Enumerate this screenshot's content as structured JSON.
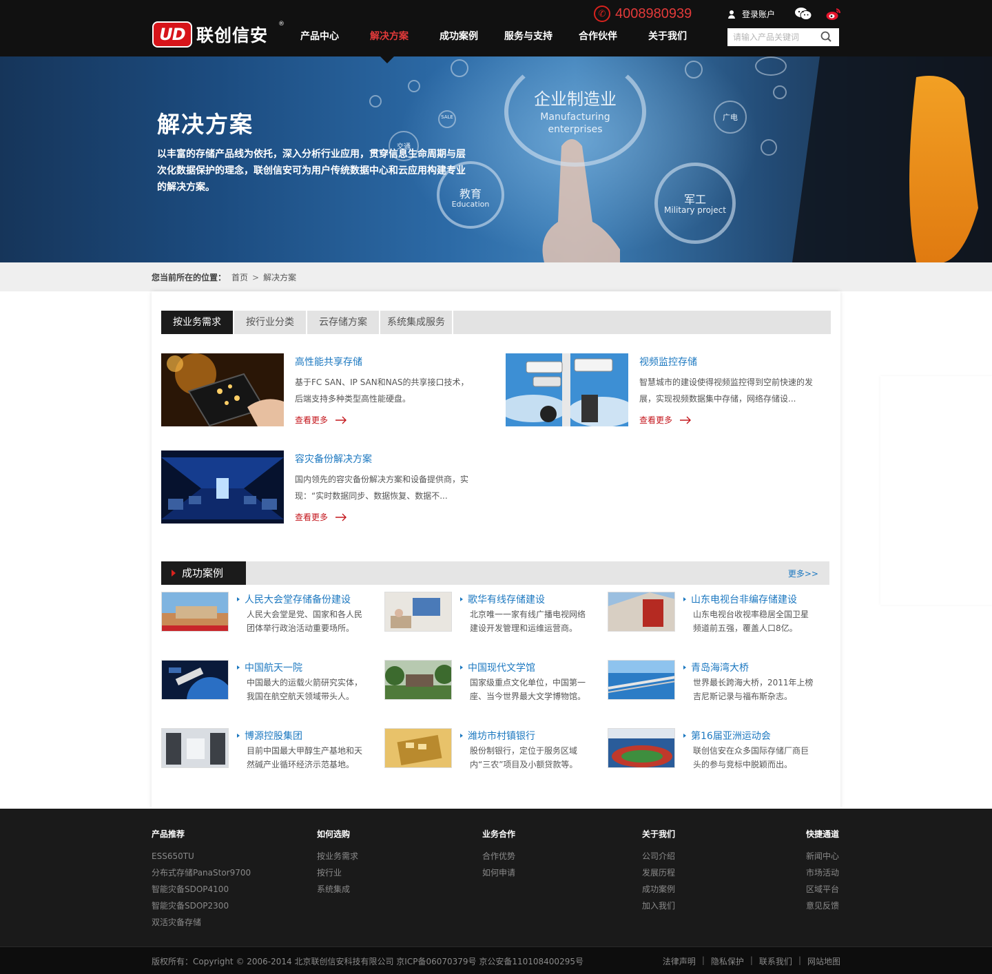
{
  "header": {
    "logo_badge": "UD",
    "logo_text": "联创信安",
    "logo_reg": "®",
    "phone": "4008980939",
    "login_label": "登录账户",
    "search_placeholder": "请输入产品关键词",
    "nav": [
      {
        "label": "产品中心",
        "active": false
      },
      {
        "label": "解决方案",
        "active": true
      },
      {
        "label": "成功案例",
        "active": false
      },
      {
        "label": "服务与支持",
        "active": false
      },
      {
        "label": "合作伙伴",
        "active": false
      },
      {
        "label": "关于我们",
        "active": false
      }
    ]
  },
  "banner": {
    "title": "解决方案",
    "desc": "以丰富的存储产品线为依托，深入分析行业应用，贯穿信息生命周期与层次化数据保护的理念，联创信安可为用户传统数据中心和云应用构建专业的解决方案。",
    "ring_main_cn": "企业制造业",
    "ring_main_en1": "Manufacturing",
    "ring_main_en2": "enterprises",
    "ring_edu_cn": "教育",
    "ring_edu_en": "Education",
    "ring_mil_cn": "军工",
    "ring_mil_en": "Military project",
    "bubble_tv": "广电",
    "bubble_traffic": "交通",
    "bubble_sale": "SALE"
  },
  "breadcrumb": {
    "label": "您当前所在的位置：",
    "home": "首页",
    "sep": ">",
    "current": "解决方案"
  },
  "tabs": [
    {
      "label": "按业务需求",
      "active": true
    },
    {
      "label": "按行业分类",
      "active": false
    },
    {
      "label": "云存储方案",
      "active": false
    },
    {
      "label": "系统集成服务",
      "active": false
    }
  ],
  "solutions": [
    {
      "title": "高性能共享存储",
      "desc": "基于FC SAN、IP SAN和NAS的共享接口技术，后端支持多种类型高性能硬盘。",
      "more": "查看更多"
    },
    {
      "title": "视频监控存储",
      "desc": "智慧城市的建设使得视频监控得到空前快速的发展，实现视频数据集中存储，网络存储设...",
      "more": "查看更多"
    },
    {
      "title": "容灾备份解决方案",
      "desc": "国内领先的容灾备份解决方案和设备提供商，实现：“实时数据同步、数据恢复、数据不...",
      "more": "查看更多"
    }
  ],
  "cases_section": {
    "title": "成功案例",
    "more": "更多>>"
  },
  "cases": [
    {
      "title": "人民大会堂存储备份建设",
      "desc": "人民大会堂是党、国家和各人民团体举行政治活动重要场所。"
    },
    {
      "title": "歌华有线存储建设",
      "desc": "北京唯一一家有线广播电视网络建设开发管理和运维运营商。"
    },
    {
      "title": "山东电视台非编存储建设",
      "desc": "山东电视台收视率稳居全国卫星频道前五强，覆盖人口8亿。"
    },
    {
      "title": "中国航天一院",
      "desc": "中国最大的运载火箭研究实体，我国在航空航天领域带头人。"
    },
    {
      "title": "中国现代文学馆",
      "desc": "国家级重点文化单位，中国第一座、当今世界最大文学博物馆。"
    },
    {
      "title": "青岛海湾大桥",
      "desc": "世界最长跨海大桥，2011年上榜吉尼斯记录与福布斯杂志。"
    },
    {
      "title": "博源控股集团",
      "desc": "目前中国最大甲醇生产基地和天然碱产业循环经济示范基地。"
    },
    {
      "title": "潍坊市村镇银行",
      "desc": "股份制银行，定位于服务区域内“三农”项目及小额贷款等。"
    },
    {
      "title": "第16届亚洲运动会",
      "desc": "联创信安在众多国际存储厂商巨头的参与竞标中脱颖而出。"
    }
  ],
  "footer": {
    "columns": [
      {
        "title": "产品推荐",
        "links": [
          "ESS650TU",
          "分布式存储PanaStor9700",
          "智能灾备SDOP4100",
          "智能灾备SDOP2300",
          "双活灾备存储"
        ]
      },
      {
        "title": "如何选购",
        "links": [
          "按业务需求",
          "按行业",
          "系统集成"
        ]
      },
      {
        "title": "业务合作",
        "links": [
          "合作优势",
          "如何申请"
        ]
      },
      {
        "title": "关于我们",
        "links": [
          "公司介绍",
          "发展历程",
          "成功案例",
          "加入我们"
        ]
      },
      {
        "title": "快捷通道",
        "links": [
          "新闻中心",
          "市场活动",
          "区域平台",
          "意见反馈"
        ]
      }
    ],
    "copyright": "版权所有：Copyright © 2006-2014 北京联创信安科技有限公司 京ICP备06070379号 京公安备110108400295号",
    "legal": [
      "法律声明",
      "隐私保护",
      "联系我们",
      "网站地图"
    ],
    "legal_sep": "|"
  },
  "colors": {
    "accent_red": "#e23a3a",
    "link_blue": "#1c78c0",
    "header_bg": "#111111"
  }
}
